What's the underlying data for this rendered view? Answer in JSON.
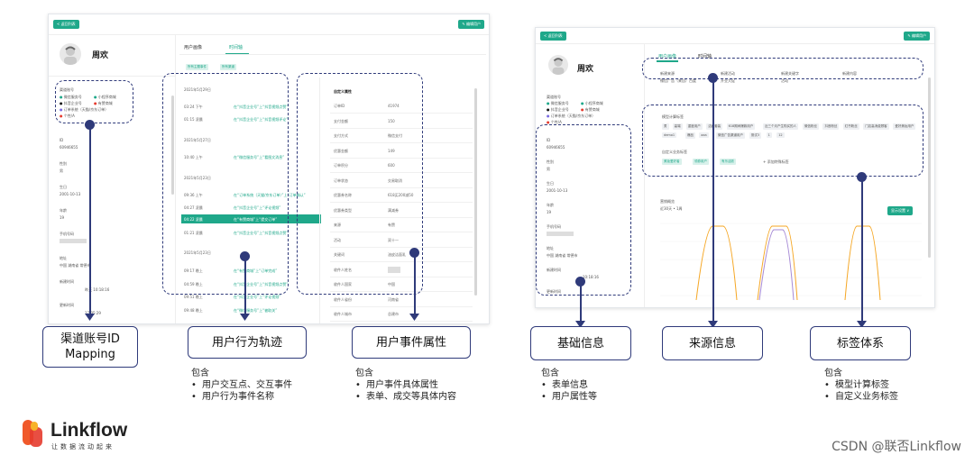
{
  "left_panel": {
    "back_button": "< 返回列表",
    "edit_button": "✎ 编辑用户",
    "user_name": "周欢",
    "tabs": [
      "用户画像",
      "时间轴"
    ],
    "filter_chips": [
      "所有主题事件",
      "所有渠道"
    ],
    "channel_heading": "渠道账号",
    "channels": [
      "微信服务号",
      "小程序商城",
      "抖音企业号",
      "有赞商城",
      "订单系统（天猫/京东订单）",
      "个性/A"
    ],
    "fields": [
      {
        "label": "ID",
        "value": "60946655"
      },
      {
        "label": "性别",
        "value": "男"
      },
      {
        "label": "生日",
        "value": "2001-10-13"
      },
      {
        "label": "年龄",
        "value": "19"
      },
      {
        "label": "手机号码",
        "value": ""
      },
      {
        "label": "地址",
        "value": "中国 湖南省 常德市"
      },
      {
        "label": "新建时间",
        "value": "昨天 10:18:16"
      },
      {
        "label": "更新时间",
        "value": "17:05:29"
      }
    ],
    "timeline_dates": [
      "2021年5月29日",
      "2021年5月27日",
      "2021年5月23日",
      "2021年5月23日"
    ],
    "timeline_rows": [
      {
        "time": "03:24 下午",
        "text": "在“抖音企业号”上“抖音视频点赞”"
      },
      {
        "time": "01:15 凌晨",
        "text": "在“抖音企业号”上“抖音视频评论”"
      },
      {
        "time": "10:40 上午",
        "text": "在“微信服务号”上“看图文消息”"
      },
      {
        "time": "09:36 上午",
        "text": "在“订单系统（天猫/京东订单）”上“订单确认”"
      },
      {
        "time": "04:27 凌晨",
        "text": "在“抖音企业号”上“评论视频”"
      },
      {
        "time": "04:22 凌晨",
        "text": "在“有赞商城”上“提交订单”"
      },
      {
        "time": "01:21 凌晨",
        "text": "在“抖音企业号”上“抖音视频点赞”"
      },
      {
        "time": "09:17 晚上",
        "text": "在“有赞商城”上“订单完成”"
      },
      {
        "time": "04:59 晚上",
        "text": "在“抖音企业号”上“抖音视频点赞”"
      },
      {
        "time": "09:51 晚上",
        "text": "在“抖音企业号”上“评论视频”"
      },
      {
        "time": "09:48 晚上",
        "text": "在“微信服务号”上“被取关”"
      }
    ],
    "attr_heading": "自定义属性",
    "attrs": [
      {
        "k": "订单ID",
        "v": "41974"
      },
      {
        "k": "支付金额",
        "v": "150"
      },
      {
        "k": "支付方式",
        "v": "微信支付"
      },
      {
        "k": "优惠金额",
        "v": "149"
      },
      {
        "k": "订单积分",
        "v": "600"
      },
      {
        "k": "订单状态",
        "v": "交易取消"
      },
      {
        "k": "优惠券名称",
        "v": "618买200减50"
      },
      {
        "k": "优惠券类型",
        "v": "满减券"
      },
      {
        "k": "来源",
        "v": "有赞"
      },
      {
        "k": "活动",
        "v": "双十一"
      },
      {
        "k": "关键词",
        "v": "油皮洁面乳"
      },
      {
        "k": "收件人姓名",
        "v": ""
      },
      {
        "k": "收件人国家",
        "v": "中国"
      },
      {
        "k": "收件人省份",
        "v": "河南省"
      },
      {
        "k": "收件人城市",
        "v": "总建市"
      }
    ]
  },
  "right_panel": {
    "back_button": "< 返回列表",
    "edit_button": "✎ 编辑用户",
    "user_name": "周欢",
    "tabs": [
      "用户画像",
      "时间轴"
    ],
    "source_headers": [
      "新建来源",
      "新建活动",
      "新建关键字",
      "新建内容"
    ],
    "source_values": [
      "微信广告（来自）百度",
      "开业大促",
      "活动",
      ""
    ],
    "channel_heading": "渠道账号",
    "channels": [
      "微信服务号",
      "小程序商城",
      "抖音企业号",
      "有赞商城",
      "订单系统（天猫/京东订单）",
      "个性/A"
    ],
    "fields": [
      {
        "label": "ID",
        "value": "60946655"
      },
      {
        "label": "性别",
        "value": "男"
      },
      {
        "label": "生日",
        "value": "2001-10-13"
      },
      {
        "label": "年龄",
        "value": "19"
      },
      {
        "label": "手机号码",
        "value": ""
      },
      {
        "label": "地址",
        "value": "中国 湖南省 常德市"
      },
      {
        "label": "新建时间",
        "value": "10:18:16"
      },
      {
        "label": "更新时间",
        "value": ""
      }
    ],
    "tag_label_1": "模型计算标签",
    "tags_1": [
      "男",
      "高端",
      "重度用户",
      "洁面套装",
      "618期间爆款用户",
      "近三个月产生购买的人",
      "微信粉丝",
      "抖音粉丝",
      "红书粉丝",
      "门店高消费顾客",
      "爱好美妆用户",
      "demo1",
      "爆品",
      "aaa",
      "微信广告渠道用户",
      "测试3",
      "1",
      "12"
    ],
    "tag_label_2": "自定义业务标签",
    "tags_2": [
      "美妆爱好者",
      "领券用户",
      "有乐活跃"
    ],
    "add_tag": "+ 添加特殊标签",
    "chart_label": "营销概览",
    "chart_sub": "近30天 • 1周",
    "chart_button": "显示设置 ∨"
  },
  "callouts": [
    {
      "title": "渠道账号ID\nMapping",
      "items": []
    },
    {
      "title": "用户行为轨迹",
      "intro": "包含",
      "items": [
        "用户交互点、交互事件",
        "用户行为事件名称"
      ]
    },
    {
      "title": "用户事件属性",
      "intro": "包含",
      "items": [
        "用户事件具体属性",
        "表单、成交等具体内容"
      ]
    },
    {
      "title": "基础信息",
      "intro": "包含",
      "items": [
        "表单信息",
        "用户属性等"
      ]
    },
    {
      "title": "来源信息",
      "items": []
    },
    {
      "title": "标签体系",
      "intro": "包含",
      "items": [
        "模型计算标签",
        "自定义业务标签"
      ]
    }
  ],
  "brand": {
    "name": "Linkflow",
    "tagline": "让数据流动起来"
  },
  "watermark": "CSDN @联否Linkflow",
  "colors": {
    "accent": "#1fa88a",
    "annotation": "#2f3a7a",
    "brand_orange": "#f0592a",
    "brand_red": "#e63b2e"
  }
}
